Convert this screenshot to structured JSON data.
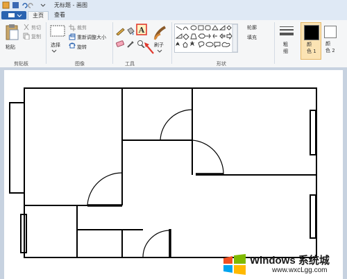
{
  "window": {
    "title": "无标题 - 画图"
  },
  "tabs": [
    {
      "label": "主页"
    },
    {
      "label": "查看"
    }
  ],
  "ribbon": {
    "clipboard": {
      "paste": "粘贴",
      "cut": "剪切",
      "copy": "复制",
      "group": "剪贴板"
    },
    "image": {
      "select": "选择",
      "crop": "裁剪",
      "resize": "重新调整大小",
      "rotate": "旋转",
      "group": "图像"
    },
    "tools": {
      "group": "工具",
      "brushes": "刷子"
    },
    "shapes": {
      "outline": "轮廓",
      "fill": "填充",
      "group": "形状"
    },
    "size": {
      "label": "粗\n细"
    },
    "color1": {
      "label": "颜\n色 1",
      "value": "#000000"
    },
    "color2": {
      "label": "颜\n色 2",
      "value": "#ffffff"
    }
  },
  "watermark": {
    "brand": "Windows 系统城",
    "url": "www.wxcLgg.com"
  }
}
